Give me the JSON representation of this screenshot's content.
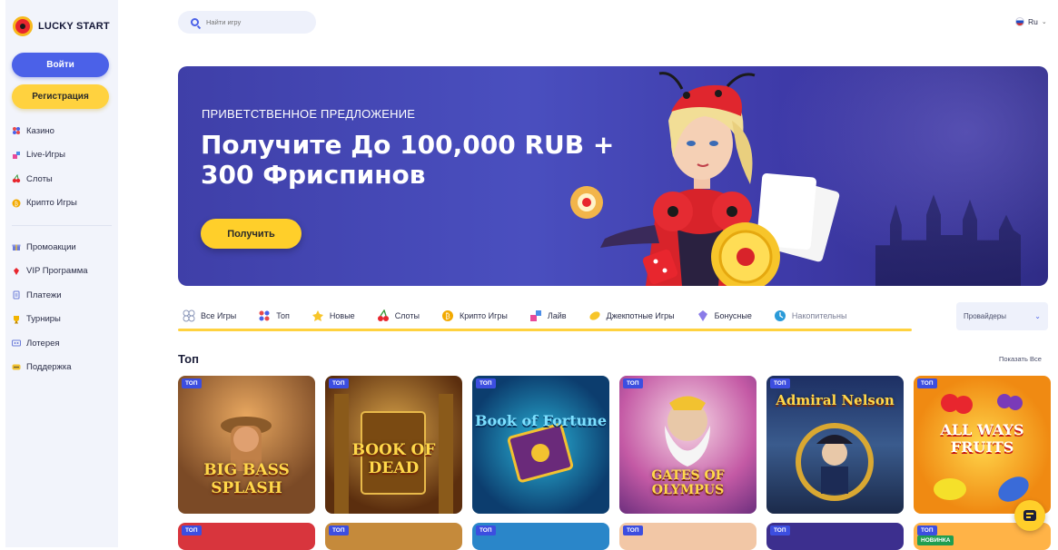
{
  "brand": {
    "name": "LUCKY START"
  },
  "auth": {
    "login_label": "Войти",
    "register_label": "Регистрация"
  },
  "sidebar": {
    "main_items": [
      {
        "label": "Казино",
        "icon": "casino-icon"
      },
      {
        "label": "Live-Игры",
        "icon": "live-games-icon"
      },
      {
        "label": "Слоты",
        "icon": "slots-icon"
      },
      {
        "label": "Крипто Игры",
        "icon": "crypto-icon"
      }
    ],
    "secondary_items": [
      {
        "label": "Промоакции",
        "icon": "gift-icon"
      },
      {
        "label": "VIP Программа",
        "icon": "vip-icon"
      },
      {
        "label": "Платежи",
        "icon": "payments-icon"
      },
      {
        "label": "Турниры",
        "icon": "trophy-icon"
      },
      {
        "label": "Лотерея",
        "icon": "lottery-icon"
      },
      {
        "label": "Поддержка",
        "icon": "support-icon"
      }
    ]
  },
  "search": {
    "placeholder": "Найти игру",
    "value": ""
  },
  "language": {
    "label": "Ru",
    "flag": "russia-flag"
  },
  "hero": {
    "subtitle": "ПРИВЕТСТВЕННОЕ ПРЕДЛОЖЕНИЕ",
    "title": "Получите До 100,000 RUB + 300 Фриспинов",
    "button_label": "Получить"
  },
  "categories": [
    {
      "label": "Все Игры",
      "icon": "all-games-icon"
    },
    {
      "label": "Топ",
      "icon": "top-icon"
    },
    {
      "label": "Новые",
      "icon": "new-icon"
    },
    {
      "label": "Слоты",
      "icon": "slots-icon"
    },
    {
      "label": "Крипто Игры",
      "icon": "crypto-icon"
    },
    {
      "label": "Лайв",
      "icon": "live-icon"
    },
    {
      "label": "Джекпотные Игры",
      "icon": "jackpot-icon"
    },
    {
      "label": "Бонусные",
      "icon": "bonus-icon"
    },
    {
      "label": "Накопительны",
      "icon": "accumulative-icon"
    }
  ],
  "providers": {
    "label": "Провайдеры"
  },
  "section": {
    "title": "Топ",
    "show_all_label": "Показать Все"
  },
  "games": [
    {
      "name": "BIG BASS SPLASH",
      "badge": "ТОП"
    },
    {
      "name": "BOOK OF DEAD",
      "badge": "ТОП"
    },
    {
      "name": "Book of Fortune",
      "badge": "ТОП"
    },
    {
      "name": "GATES OF OLYMPUS",
      "badge": "ТОП"
    },
    {
      "name": "Admiral Nelson",
      "badge": "ТОП"
    },
    {
      "name": "ALL WAYS FRUITS",
      "badge": "ТОП"
    }
  ],
  "games_row2": [
    {
      "badge": "ТОП"
    },
    {
      "badge": "ТОП"
    },
    {
      "badge": "ТОП"
    },
    {
      "badge": "ТОП"
    },
    {
      "badge": "ТОП"
    },
    {
      "badge": "ТОП",
      "badge2": "НОВИНКА"
    }
  ],
  "colors": {
    "accent_blue": "#4b61e8",
    "accent_yellow": "#ffd23f",
    "hero_bg": "#4a4fbf",
    "badge": "#3c4ee0"
  }
}
